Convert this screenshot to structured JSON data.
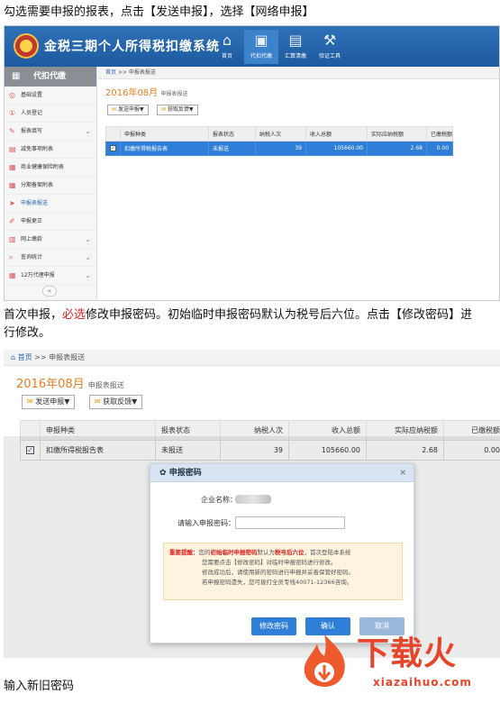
{
  "doc": {
    "intro": "勾选需要申报的报表，点击【发送申报】，选择【网络申报】",
    "para2_a": "首次申报，",
    "para2_b": "必选",
    "para2_c": "修改申报密码。初始临时申报密码默认为税号后六位。点击【修改密码】进",
    "para2_d": "行修改。",
    "footer": "输入新旧密码"
  },
  "shot1": {
    "app_title": "金税三期个人所得税扣缴系统",
    "nav": [
      "首页",
      "代扣代缴",
      "汇算清缴",
      "验证工具"
    ],
    "nav_icons": [
      "home-icon",
      "briefcase-icon",
      "calculator-icon",
      "tools-icon"
    ],
    "sidebar_title": "代扣代缴",
    "sidebar_items": [
      "基础设置",
      "人员登记",
      "报表填写",
      "减免事项附表",
      "商业健康保险附表",
      "分期备案附表",
      "申报表报送",
      "申报更正",
      "网上缴款",
      "查询统计",
      "12万代理申报"
    ],
    "active_item": "申报表报送",
    "breadcrumb_home": "首页",
    "breadcrumb_sep": ">>",
    "breadcrumb_page": "申报表报送",
    "period": "2016年08月",
    "period_label": "申报表报送",
    "btn_send": "发送申报▼",
    "btn_feedback": "获取反馈▼",
    "columns": [
      "申报种类",
      "报表状态",
      "纳税人次",
      "收入总额",
      "实际应纳税额",
      "已缴税额"
    ],
    "row": {
      "type": "扣缴所得税报告表",
      "status": "未报送",
      "persons": "39",
      "income": "105660.00",
      "tax": "2.68",
      "paid": "0.00"
    }
  },
  "shot2": {
    "breadcrumb_home": "首页",
    "breadcrumb_sep": ">>",
    "breadcrumb_page": "申报表报送",
    "period": "2016年08月",
    "period_label": "申报表报送",
    "btn_send": "发送申报▼",
    "btn_feedback": "获取反馈▼",
    "columns": [
      "申报种类",
      "报表状态",
      "纳税人次",
      "收入总额",
      "实际应纳税额",
      "已缴税额"
    ],
    "row": {
      "type": "扣缴所得税报告表",
      "status": "未报送",
      "persons": "39",
      "income": "105660.00",
      "tax": "2.68",
      "paid": "0.00"
    },
    "dialog": {
      "title": "申报密码",
      "close": "×",
      "company_label": "企业名称：",
      "password_label": "请输入申报密码：",
      "password_value": "",
      "notice_label": "重要提醒：",
      "notice_1a": "您的",
      "notice_1b": "初始临时申报密码",
      "notice_1c": "默认为",
      "notice_1d": "税号后六位",
      "notice_1e": "，首次登陆本系统",
      "notice_2": "您需要点击【修改密码】对临时申报密码进行修改。",
      "notice_3": "修改成功后，请使用新的密码进行申报并妥善保管好密码。",
      "notice_4": "若申报密码遗失，您可拨打全员专线40071-12366咨询。",
      "btn_change": "修改密码",
      "btn_ok": "确认",
      "btn_cancel": "取消"
    }
  },
  "watermark": {
    "title": "下载火",
    "url": "xiazaihuo.com"
  }
}
